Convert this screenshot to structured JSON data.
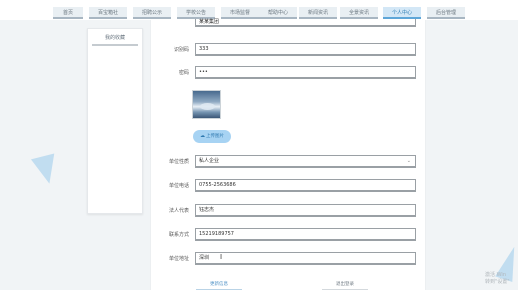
{
  "nav": {
    "tabs": [
      {
        "label": "首页",
        "active": false
      },
      {
        "label": "百宝箱社",
        "active": false
      },
      {
        "label": "招聘公示",
        "active": false
      },
      {
        "label": "学校公告",
        "active": false
      },
      {
        "label": "市场监督",
        "active": false
      },
      {
        "label": "帮助中心",
        "active": false
      },
      {
        "label": "新闻资讯",
        "active": false
      },
      {
        "label": "全景资讯",
        "active": false
      },
      {
        "label": "个人中心",
        "active": true
      },
      {
        "label": "后台管理",
        "active": false
      }
    ]
  },
  "sidebar": {
    "items": [
      {
        "label": "我的收藏"
      }
    ]
  },
  "form": {
    "top_partial_value": "某某集团",
    "account": {
      "label": "识别码",
      "value": "333"
    },
    "password": {
      "label": "密码",
      "value": "•••"
    },
    "upload_button": "上传图片",
    "unit_type": {
      "label": "单位性质",
      "value": "私人企业"
    },
    "unit_phone": {
      "label": "单位电话",
      "value": "0755-2563686"
    },
    "legal_rep": {
      "label": "法人代表",
      "value": "钰志杰"
    },
    "contact": {
      "label": "联系方式",
      "value": "15219189757"
    },
    "address": {
      "label": "单位地址",
      "value": "深圳"
    }
  },
  "footer": {
    "update_button": "更新信息",
    "logout_button": "退出登录"
  },
  "watermark": {
    "line1": "激活 Win",
    "line2": "转到\"设置\""
  },
  "colors": {
    "accent": "#5ea6d8",
    "button_bg": "#a7d3f3",
    "background": "#f1f4f6"
  }
}
